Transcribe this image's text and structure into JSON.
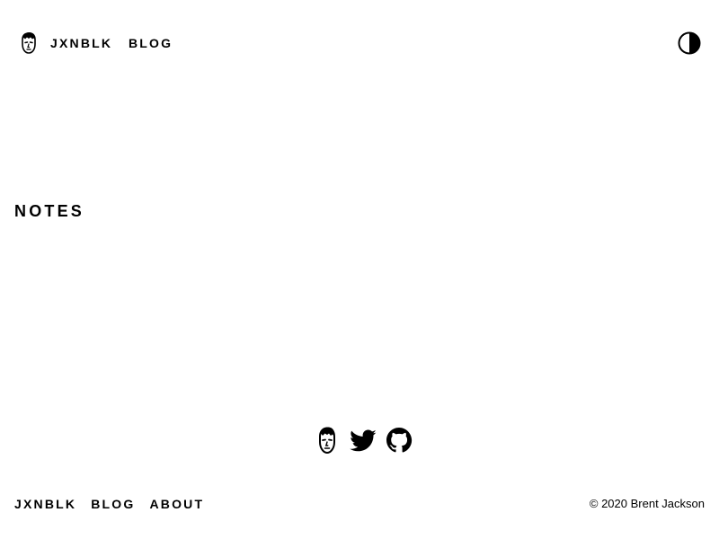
{
  "header": {
    "brand_label": "JXNBLK",
    "nav_blog_label": "BLOG",
    "avatar_icon": "avatar-face-icon",
    "theme_toggle_icon": "half-circle-contrast-icon"
  },
  "main": {
    "title": "NOTES"
  },
  "social": {
    "items": [
      {
        "icon": "avatar-face-icon"
      },
      {
        "icon": "twitter-icon"
      },
      {
        "icon": "github-icon"
      }
    ]
  },
  "footer": {
    "nav": [
      "JXNBLK",
      "BLOG",
      "ABOUT"
    ],
    "copyright": "© 2020 Brent Jackson"
  },
  "colors": {
    "background": "#ffffff",
    "text": "#000000"
  }
}
